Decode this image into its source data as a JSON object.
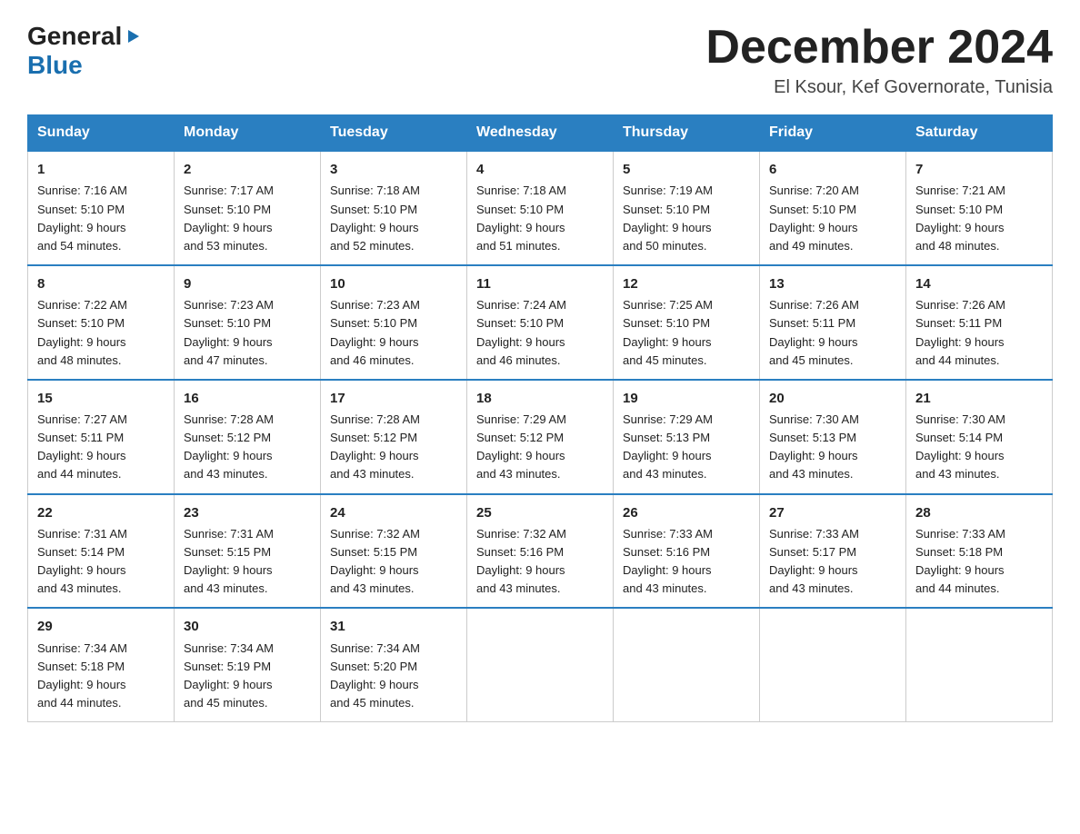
{
  "header": {
    "logo_general": "General",
    "logo_triangle": "▶",
    "logo_blue": "Blue",
    "month_title": "December 2024",
    "location": "El Ksour, Kef Governorate, Tunisia"
  },
  "weekdays": [
    "Sunday",
    "Monday",
    "Tuesday",
    "Wednesday",
    "Thursday",
    "Friday",
    "Saturday"
  ],
  "weeks": [
    [
      {
        "day": "1",
        "sunrise": "7:16 AM",
        "sunset": "5:10 PM",
        "daylight": "9 hours and 54 minutes."
      },
      {
        "day": "2",
        "sunrise": "7:17 AM",
        "sunset": "5:10 PM",
        "daylight": "9 hours and 53 minutes."
      },
      {
        "day": "3",
        "sunrise": "7:18 AM",
        "sunset": "5:10 PM",
        "daylight": "9 hours and 52 minutes."
      },
      {
        "day": "4",
        "sunrise": "7:18 AM",
        "sunset": "5:10 PM",
        "daylight": "9 hours and 51 minutes."
      },
      {
        "day": "5",
        "sunrise": "7:19 AM",
        "sunset": "5:10 PM",
        "daylight": "9 hours and 50 minutes."
      },
      {
        "day": "6",
        "sunrise": "7:20 AM",
        "sunset": "5:10 PM",
        "daylight": "9 hours and 49 minutes."
      },
      {
        "day": "7",
        "sunrise": "7:21 AM",
        "sunset": "5:10 PM",
        "daylight": "9 hours and 48 minutes."
      }
    ],
    [
      {
        "day": "8",
        "sunrise": "7:22 AM",
        "sunset": "5:10 PM",
        "daylight": "9 hours and 48 minutes."
      },
      {
        "day": "9",
        "sunrise": "7:23 AM",
        "sunset": "5:10 PM",
        "daylight": "9 hours and 47 minutes."
      },
      {
        "day": "10",
        "sunrise": "7:23 AM",
        "sunset": "5:10 PM",
        "daylight": "9 hours and 46 minutes."
      },
      {
        "day": "11",
        "sunrise": "7:24 AM",
        "sunset": "5:10 PM",
        "daylight": "9 hours and 46 minutes."
      },
      {
        "day": "12",
        "sunrise": "7:25 AM",
        "sunset": "5:10 PM",
        "daylight": "9 hours and 45 minutes."
      },
      {
        "day": "13",
        "sunrise": "7:26 AM",
        "sunset": "5:11 PM",
        "daylight": "9 hours and 45 minutes."
      },
      {
        "day": "14",
        "sunrise": "7:26 AM",
        "sunset": "5:11 PM",
        "daylight": "9 hours and 44 minutes."
      }
    ],
    [
      {
        "day": "15",
        "sunrise": "7:27 AM",
        "sunset": "5:11 PM",
        "daylight": "9 hours and 44 minutes."
      },
      {
        "day": "16",
        "sunrise": "7:28 AM",
        "sunset": "5:12 PM",
        "daylight": "9 hours and 43 minutes."
      },
      {
        "day": "17",
        "sunrise": "7:28 AM",
        "sunset": "5:12 PM",
        "daylight": "9 hours and 43 minutes."
      },
      {
        "day": "18",
        "sunrise": "7:29 AM",
        "sunset": "5:12 PM",
        "daylight": "9 hours and 43 minutes."
      },
      {
        "day": "19",
        "sunrise": "7:29 AM",
        "sunset": "5:13 PM",
        "daylight": "9 hours and 43 minutes."
      },
      {
        "day": "20",
        "sunrise": "7:30 AM",
        "sunset": "5:13 PM",
        "daylight": "9 hours and 43 minutes."
      },
      {
        "day": "21",
        "sunrise": "7:30 AM",
        "sunset": "5:14 PM",
        "daylight": "9 hours and 43 minutes."
      }
    ],
    [
      {
        "day": "22",
        "sunrise": "7:31 AM",
        "sunset": "5:14 PM",
        "daylight": "9 hours and 43 minutes."
      },
      {
        "day": "23",
        "sunrise": "7:31 AM",
        "sunset": "5:15 PM",
        "daylight": "9 hours and 43 minutes."
      },
      {
        "day": "24",
        "sunrise": "7:32 AM",
        "sunset": "5:15 PM",
        "daylight": "9 hours and 43 minutes."
      },
      {
        "day": "25",
        "sunrise": "7:32 AM",
        "sunset": "5:16 PM",
        "daylight": "9 hours and 43 minutes."
      },
      {
        "day": "26",
        "sunrise": "7:33 AM",
        "sunset": "5:16 PM",
        "daylight": "9 hours and 43 minutes."
      },
      {
        "day": "27",
        "sunrise": "7:33 AM",
        "sunset": "5:17 PM",
        "daylight": "9 hours and 43 minutes."
      },
      {
        "day": "28",
        "sunrise": "7:33 AM",
        "sunset": "5:18 PM",
        "daylight": "9 hours and 44 minutes."
      }
    ],
    [
      {
        "day": "29",
        "sunrise": "7:34 AM",
        "sunset": "5:18 PM",
        "daylight": "9 hours and 44 minutes."
      },
      {
        "day": "30",
        "sunrise": "7:34 AM",
        "sunset": "5:19 PM",
        "daylight": "9 hours and 45 minutes."
      },
      {
        "day": "31",
        "sunrise": "7:34 AM",
        "sunset": "5:20 PM",
        "daylight": "9 hours and 45 minutes."
      },
      null,
      null,
      null,
      null
    ]
  ]
}
